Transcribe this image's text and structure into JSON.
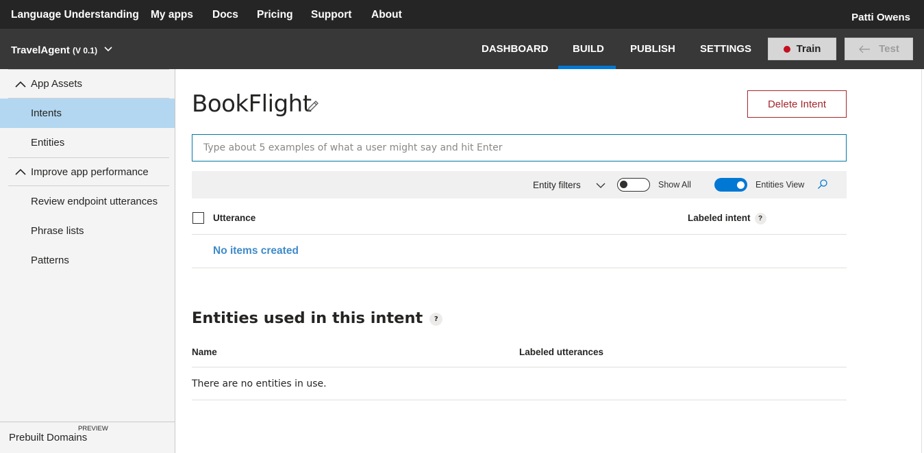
{
  "topnav": {
    "brand": "Language Understanding",
    "links": [
      "My apps",
      "Docs",
      "Pricing",
      "Support",
      "About"
    ],
    "user": "Patti Owens"
  },
  "subnav": {
    "app_name": "TravelAgent",
    "version": "(V 0.1)",
    "tabs": [
      "DASHBOARD",
      "BUILD",
      "PUBLISH",
      "SETTINGS"
    ],
    "active_tab": "BUILD",
    "train_label": "Train",
    "test_label": "Test",
    "accent_color": "#0078d4"
  },
  "sidebar": {
    "sections": [
      {
        "label": "App Assets",
        "items": [
          "Intents",
          "Entities"
        ]
      },
      {
        "label": "Improve app performance",
        "items": [
          "Review endpoint utterances",
          "Phrase lists",
          "Patterns"
        ]
      }
    ],
    "active_item": "Intents",
    "prebuilt_label": "Prebuilt Domains",
    "preview_badge": "PREVIEW"
  },
  "main": {
    "intent_name": "BookFlight",
    "delete_label": "Delete Intent",
    "utterance_placeholder": "Type about 5 examples of what a user might say and hit Enter",
    "filters": {
      "entity_filters_label": "Entity filters",
      "show_all_label": "Show All",
      "show_all_on": false,
      "entities_view_label": "Entities View",
      "entities_view_on": true
    },
    "table": {
      "col_utterance": "Utterance",
      "col_labeled_intent": "Labeled intent",
      "empty_text": "No items created"
    },
    "entities": {
      "title": "Entities used in this intent",
      "col_name": "Name",
      "col_labeled_utterances": "Labeled utterances",
      "empty_text": "There are no entities in use."
    },
    "help_glyph": "?"
  }
}
